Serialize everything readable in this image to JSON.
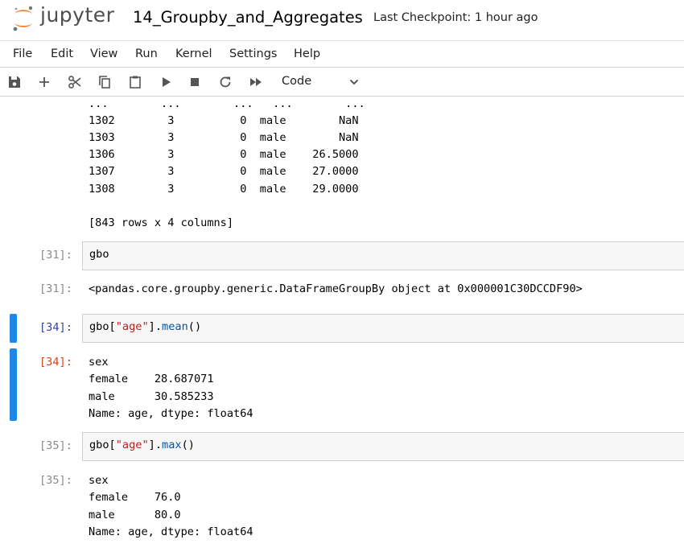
{
  "header": {
    "logo_text": "jupyter",
    "notebook_title": "14_Groupby_and_Aggregates",
    "checkpoint": "Last Checkpoint: 1 hour ago"
  },
  "menu": {
    "items": [
      "File",
      "Edit",
      "View",
      "Run",
      "Kernel",
      "Settings",
      "Help"
    ]
  },
  "toolbar": {
    "buttons": [
      "save-icon",
      "add-cell-icon",
      "cut-icon",
      "copy-icon",
      "paste-icon",
      "run-icon",
      "stop-icon",
      "restart-icon",
      "fast-forward-icon"
    ],
    "cell_type": "Code"
  },
  "cells": {
    "df_output_lines": [
      "...        ...        ...   ...        ...",
      "1302        3          0  male        NaN",
      "1303        3          0  male        NaN",
      "1306        3          0  male    26.5000",
      "1307        3          0  male    27.0000",
      "1308        3          0  male    29.0000",
      "",
      "[843 rows x 4 columns]"
    ],
    "c31": {
      "in_prompt": "[31]:",
      "code": "gbo",
      "out_prompt": "[31]:",
      "output": "<pandas.core.groupby.generic.DataFrameGroupBy object at 0x000001C30DCCDF90>"
    },
    "c34": {
      "in_prompt": "[34]:",
      "code_var": "gbo[",
      "code_str": "\"age\"",
      "code_mid": "].",
      "code_fn": "mean",
      "code_end": "()",
      "out_prompt": "[34]:",
      "output_lines": [
        "sex",
        "female    28.687071",
        "male      30.585233",
        "Name: age, dtype: float64"
      ]
    },
    "c35": {
      "in_prompt": "[35]:",
      "code_var": "gbo[",
      "code_str": "\"age\"",
      "code_mid": "].",
      "code_fn": "max",
      "code_end": "()",
      "out_prompt": "[35]:",
      "output_lines": [
        "sex",
        "female    76.0",
        "male      80.0",
        "Name: age, dtype: float64"
      ]
    }
  }
}
